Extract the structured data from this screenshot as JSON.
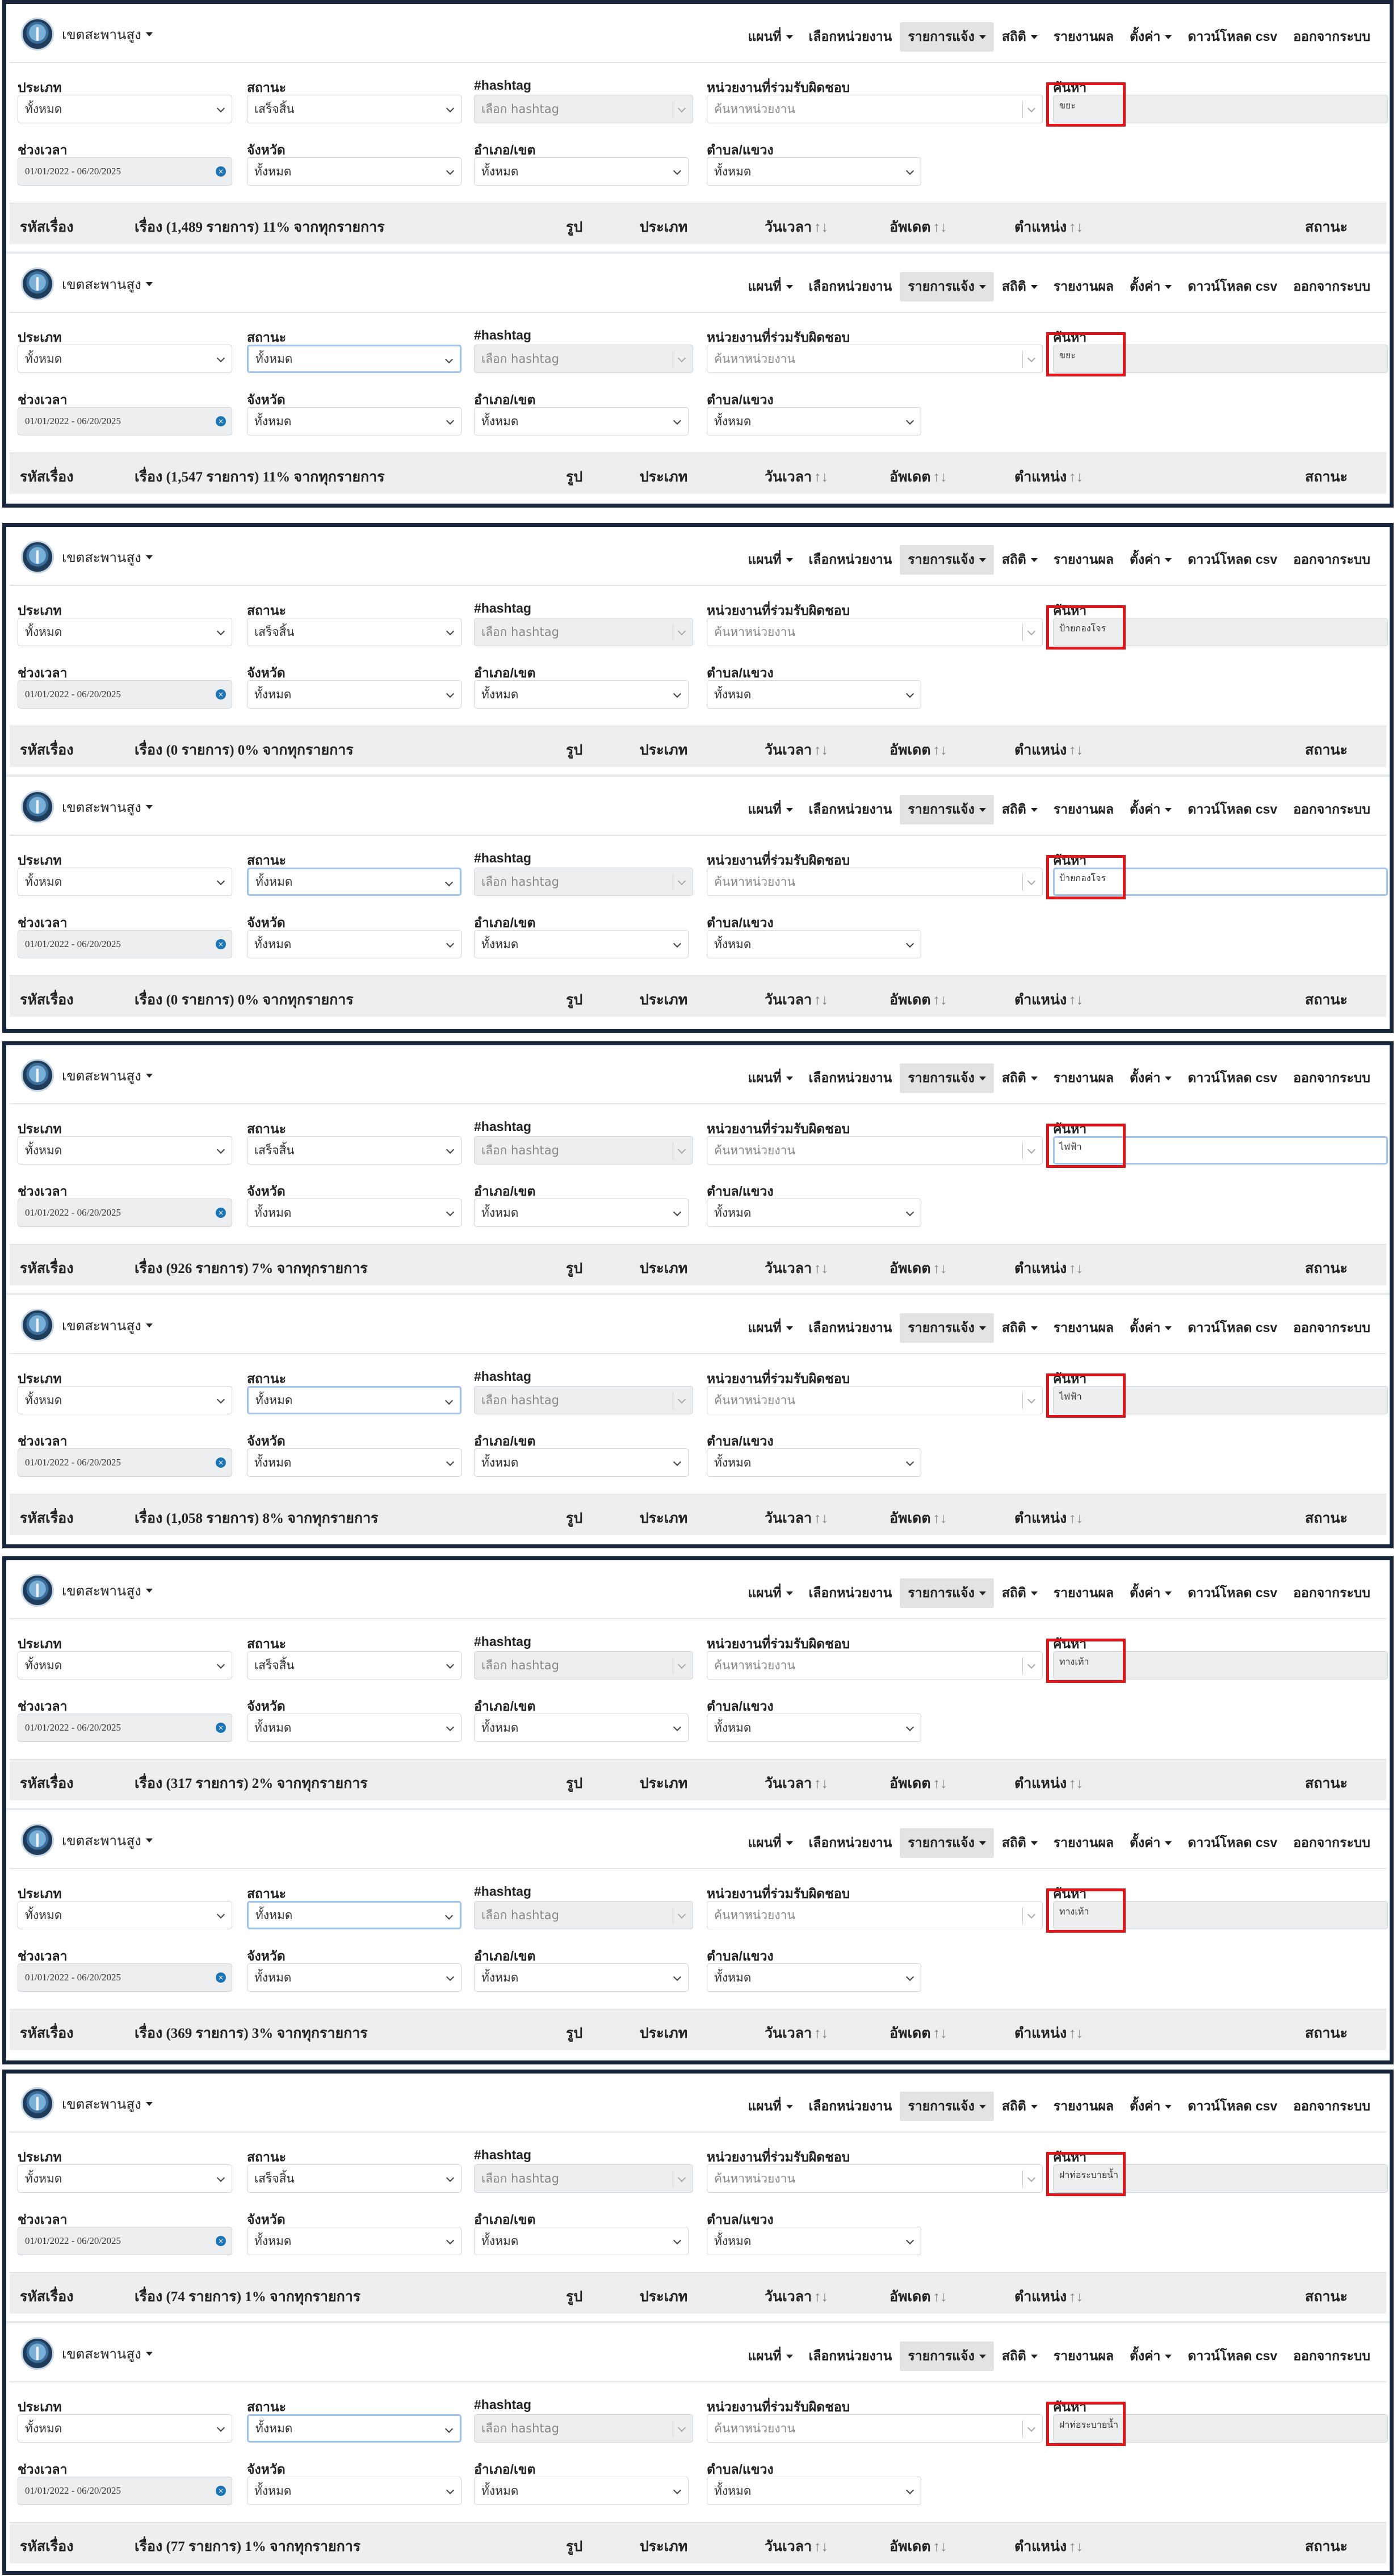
{
  "nav": {
    "brand": "เขตสะพานสูง",
    "items": [
      "แผนที่",
      "เลือกหน่วยงาน",
      "รายการแจ้ง",
      "สถิติ",
      "รายงานผล",
      "ตั้งค่า",
      "ดาวน์โหลด csv",
      "ออกจากระบบ"
    ],
    "active_index": 2
  },
  "labels": {
    "type": "ประเภท",
    "status": "สถานะ",
    "hashtag": "#hashtag",
    "agency": "หน่วยงานที่ร่วมรับผิดชอบ",
    "search": "ค้นหา",
    "period": "ช่วงเวลา",
    "province": "จังหวัด",
    "district": "อำเภอ/เขต",
    "subdistrict": "ตำบล/แขวง"
  },
  "placeholders": {
    "hashtag": "เลือก hashtag",
    "agency": "ค้นหาหน่วยงาน"
  },
  "values": {
    "all": "ทั้งหมด",
    "completed": "เสร็จสิ้น",
    "date_range": "01/01/2022 - 06/20/2025"
  },
  "table_headers": {
    "id": "รหัสเรื่อง",
    "image": "รูป",
    "type": "ประเภท",
    "datetime": "วันเวลา",
    "updated": "อัพเดต",
    "position": "ตำแหน่ง",
    "status": "สถานะ",
    "sort_icon": "↑↓"
  },
  "panels": [
    {
      "status": "เสร็จสิ้น",
      "search": "ขยะ",
      "count": "เรื่อง (1,489 รายการ) 11% จากทุกรายการ"
    },
    {
      "status": "ทั้งหมด",
      "search": "ขยะ",
      "count": "เรื่อง (1,547 รายการ) 11% จากทุกรายการ"
    },
    {
      "status": "เสร็จสิ้น",
      "search": "ป้ายกองโจร",
      "count": "เรื่อง (0 รายการ) 0% จากทุกรายการ"
    },
    {
      "status": "ทั้งหมด",
      "search": "ป้ายกองโจร",
      "count": "เรื่อง (0 รายการ) 0% จากทุกรายการ"
    },
    {
      "status": "เสร็จสิ้น",
      "search": "ไฟฟ้า",
      "count": "เรื่อง (926 รายการ) 7% จากทุกรายการ"
    },
    {
      "status": "ทั้งหมด",
      "search": "ไฟฟ้า",
      "count": "เรื่อง (1,058 รายการ) 8% จากทุกรายการ"
    },
    {
      "status": "เสร็จสิ้น",
      "search": "ทางเท้า",
      "count": "เรื่อง (317 รายการ) 2% จากทุกรายการ"
    },
    {
      "status": "ทั้งหมด",
      "search": "ทางเท้า",
      "count": "เรื่อง (369 รายการ) 3% จากทุกรายการ"
    },
    {
      "status": "เสร็จสิ้น",
      "search": "ฝาท่อระบายน้ำ",
      "count": "เรื่อง (74 รายการ) 1% จากทุกรายการ"
    },
    {
      "status": "ทั้งหมด",
      "search": "ฝาท่อระบายน้ำ",
      "count": "เรื่อง (77 รายการ) 1% จากทุกรายการ"
    }
  ],
  "colors": {
    "frame": "#17263a",
    "highlight": "#e0151a",
    "focus": "#9fc3ec",
    "header_bg": "#eeeeee"
  }
}
